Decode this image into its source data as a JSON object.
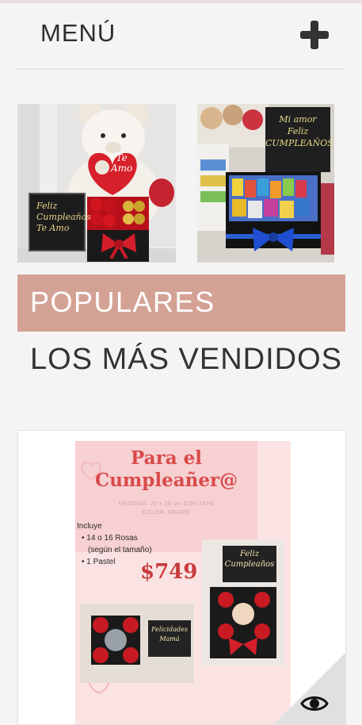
{
  "header": {
    "menu_label": "MENÚ",
    "plus_icon": "plus-icon"
  },
  "photos": [
    {
      "sign_text": [
        "Feliz",
        "Cumpleaños",
        "Te Amo"
      ],
      "heart_text": [
        "Te",
        "Amo"
      ]
    },
    {
      "sign_text": [
        "Mi amor",
        "Feliz",
        "CUMPLEAÑOS"
      ]
    }
  ],
  "section": {
    "popular_label": "POPULARES",
    "title": "LOS MÁS VENDIDOS"
  },
  "product": {
    "title_line1": "Para el",
    "title_line2": "Cumpleañer@",
    "sub1": "MEDIDAS: 20 x 20 cm CON TAPA",
    "sub2": "COLOR: NEGRO",
    "includes_label": "Incluye",
    "bullet1a": "• 14 o 16 Rosas",
    "bullet1b": "(según el tamaño)",
    "bullet2": "• 1 Pastel",
    "price": "$749",
    "sign1": [
      "Feliz",
      "Cumpleaños"
    ],
    "sign2": [
      "Felicidades",
      "Mamá"
    ],
    "eye_icon": "eye-icon"
  },
  "colors": {
    "accent": "#d4a295",
    "title_red": "#d94a4a",
    "price_red": "#c93b3b",
    "flyer_pink": "#f9d7d9"
  }
}
